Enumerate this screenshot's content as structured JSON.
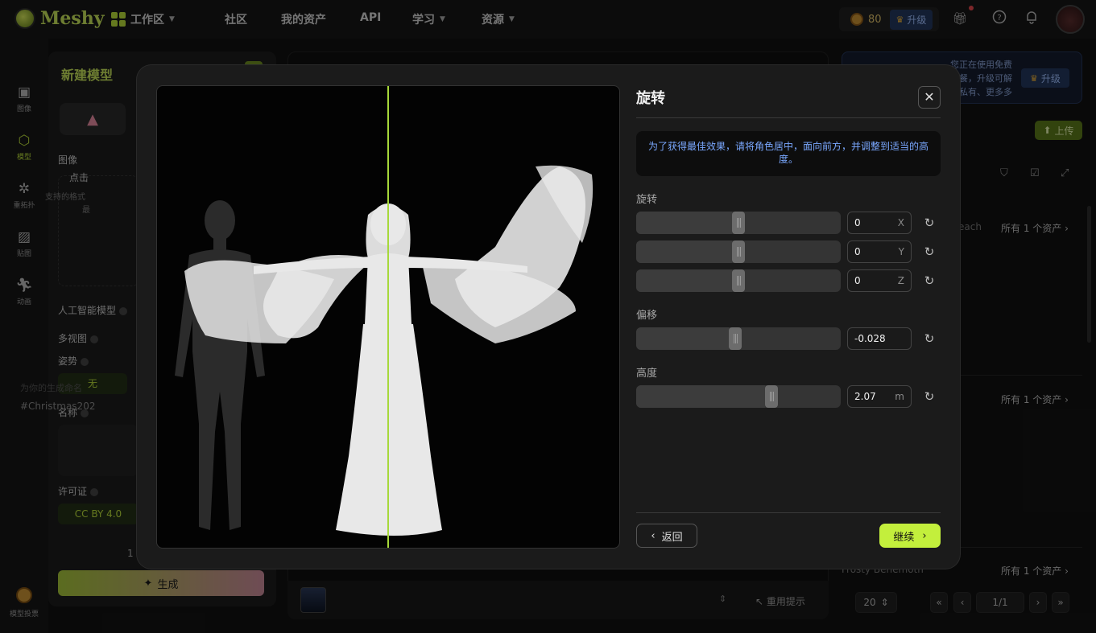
{
  "app": {
    "brand": "Meshy"
  },
  "nav": {
    "workspace": "工作区",
    "community": "社区",
    "assets": "我的资产",
    "api": "API",
    "learn": "学习",
    "resources": "资源"
  },
  "header": {
    "credits": "80",
    "upgrade_label": "升级"
  },
  "rail": {
    "items": [
      {
        "label": "图像",
        "icon": "image-ai-icon"
      },
      {
        "label": "模型",
        "icon": "cube-icon"
      },
      {
        "label": "重拓扑",
        "icon": "retopology-icon"
      },
      {
        "label": "贴图",
        "icon": "texture-icon"
      },
      {
        "label": "动画",
        "icon": "running-icon"
      }
    ],
    "bottom_label": "模型投票"
  },
  "form": {
    "title": "新建模型",
    "image_label": "图像",
    "drop_title": "点击",
    "drop_sub": "支持的格式",
    "drop_sub2": "最",
    "ai_model_label": "人工智能模型",
    "multiview_label": "多视图",
    "pose_label": "姿势",
    "pose_value": "无",
    "name_label": "名称",
    "name_placeholder": "为你的生成命名",
    "name_tag": "#Christmas202",
    "license_label": "许可证",
    "license_value": "CC BY 4.0",
    "count_text": "1",
    "generate_label": "生成"
  },
  "center": {
    "reuse_label": "重用提示"
  },
  "right": {
    "notice_text": "您正在使用免费套餐，升级可解锁私有、更多多边形选项和其他功能!",
    "notice_button": "升级",
    "upload_label": "上传",
    "asset_count_label": "所有 1 个资产",
    "asset_left_1": "each",
    "asset_left_3": "Frosty Behemoth",
    "page_size": "20",
    "page_indicator": "1/1"
  },
  "modal": {
    "title": "旋转",
    "hint": "为了获得最佳效果，请将角色居中，面向前方，并调整到适当的高度。",
    "rotation_label": "旋转",
    "rotation": [
      {
        "axis": "X",
        "value": "0",
        "fraction": 0.5
      },
      {
        "axis": "Y",
        "value": "0",
        "fraction": 0.5
      },
      {
        "axis": "Z",
        "value": "0",
        "fraction": 0.5
      }
    ],
    "offset_label": "偏移",
    "offset": {
      "value": "-0.028",
      "fraction": 0.486
    },
    "height_label": "高度",
    "height": {
      "value": "2.07",
      "unit": "m",
      "fraction": 0.66
    },
    "back_label": "返回",
    "continue_label": "继续"
  },
  "colors": {
    "accent": "#c3ef3c",
    "brand": "#b9dc3a",
    "hint_text": "#7aa8ff"
  }
}
